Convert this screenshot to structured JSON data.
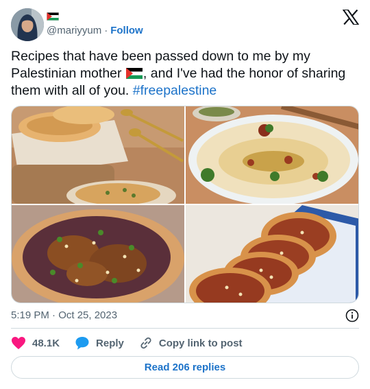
{
  "author": {
    "handle": "@mariyyum",
    "follow_label": "Follow",
    "name_flag_icon": "palestine-flag-icon"
  },
  "tweet": {
    "text_before_flag": "Recipes that have been passed down to me by my Palestinian mother ",
    "text_after_flag": ", and I've had the honor of sharing them with all of you. ",
    "hashtag": "#freepalestine",
    "inline_flag_icon": "palestine-flag-icon"
  },
  "media": {
    "photos": [
      "manakish-flatbreads-photo",
      "hummus-bowl-photo",
      "musakhan-chicken-photo",
      "sfiha-meat-pies-photo"
    ]
  },
  "meta": {
    "timestamp": "5:19 PM · Oct 25, 2023"
  },
  "actions": {
    "like_count": "48.1K",
    "reply_label": "Reply",
    "copy_link_label": "Copy link to post"
  },
  "footer": {
    "read_replies_label": "Read 206 replies"
  },
  "colors": {
    "link_blue": "#1d73c9",
    "like_pink": "#f91880",
    "reply_blue": "#1d9bf0",
    "muted_text": "#536471",
    "border": "#cfd9de"
  }
}
